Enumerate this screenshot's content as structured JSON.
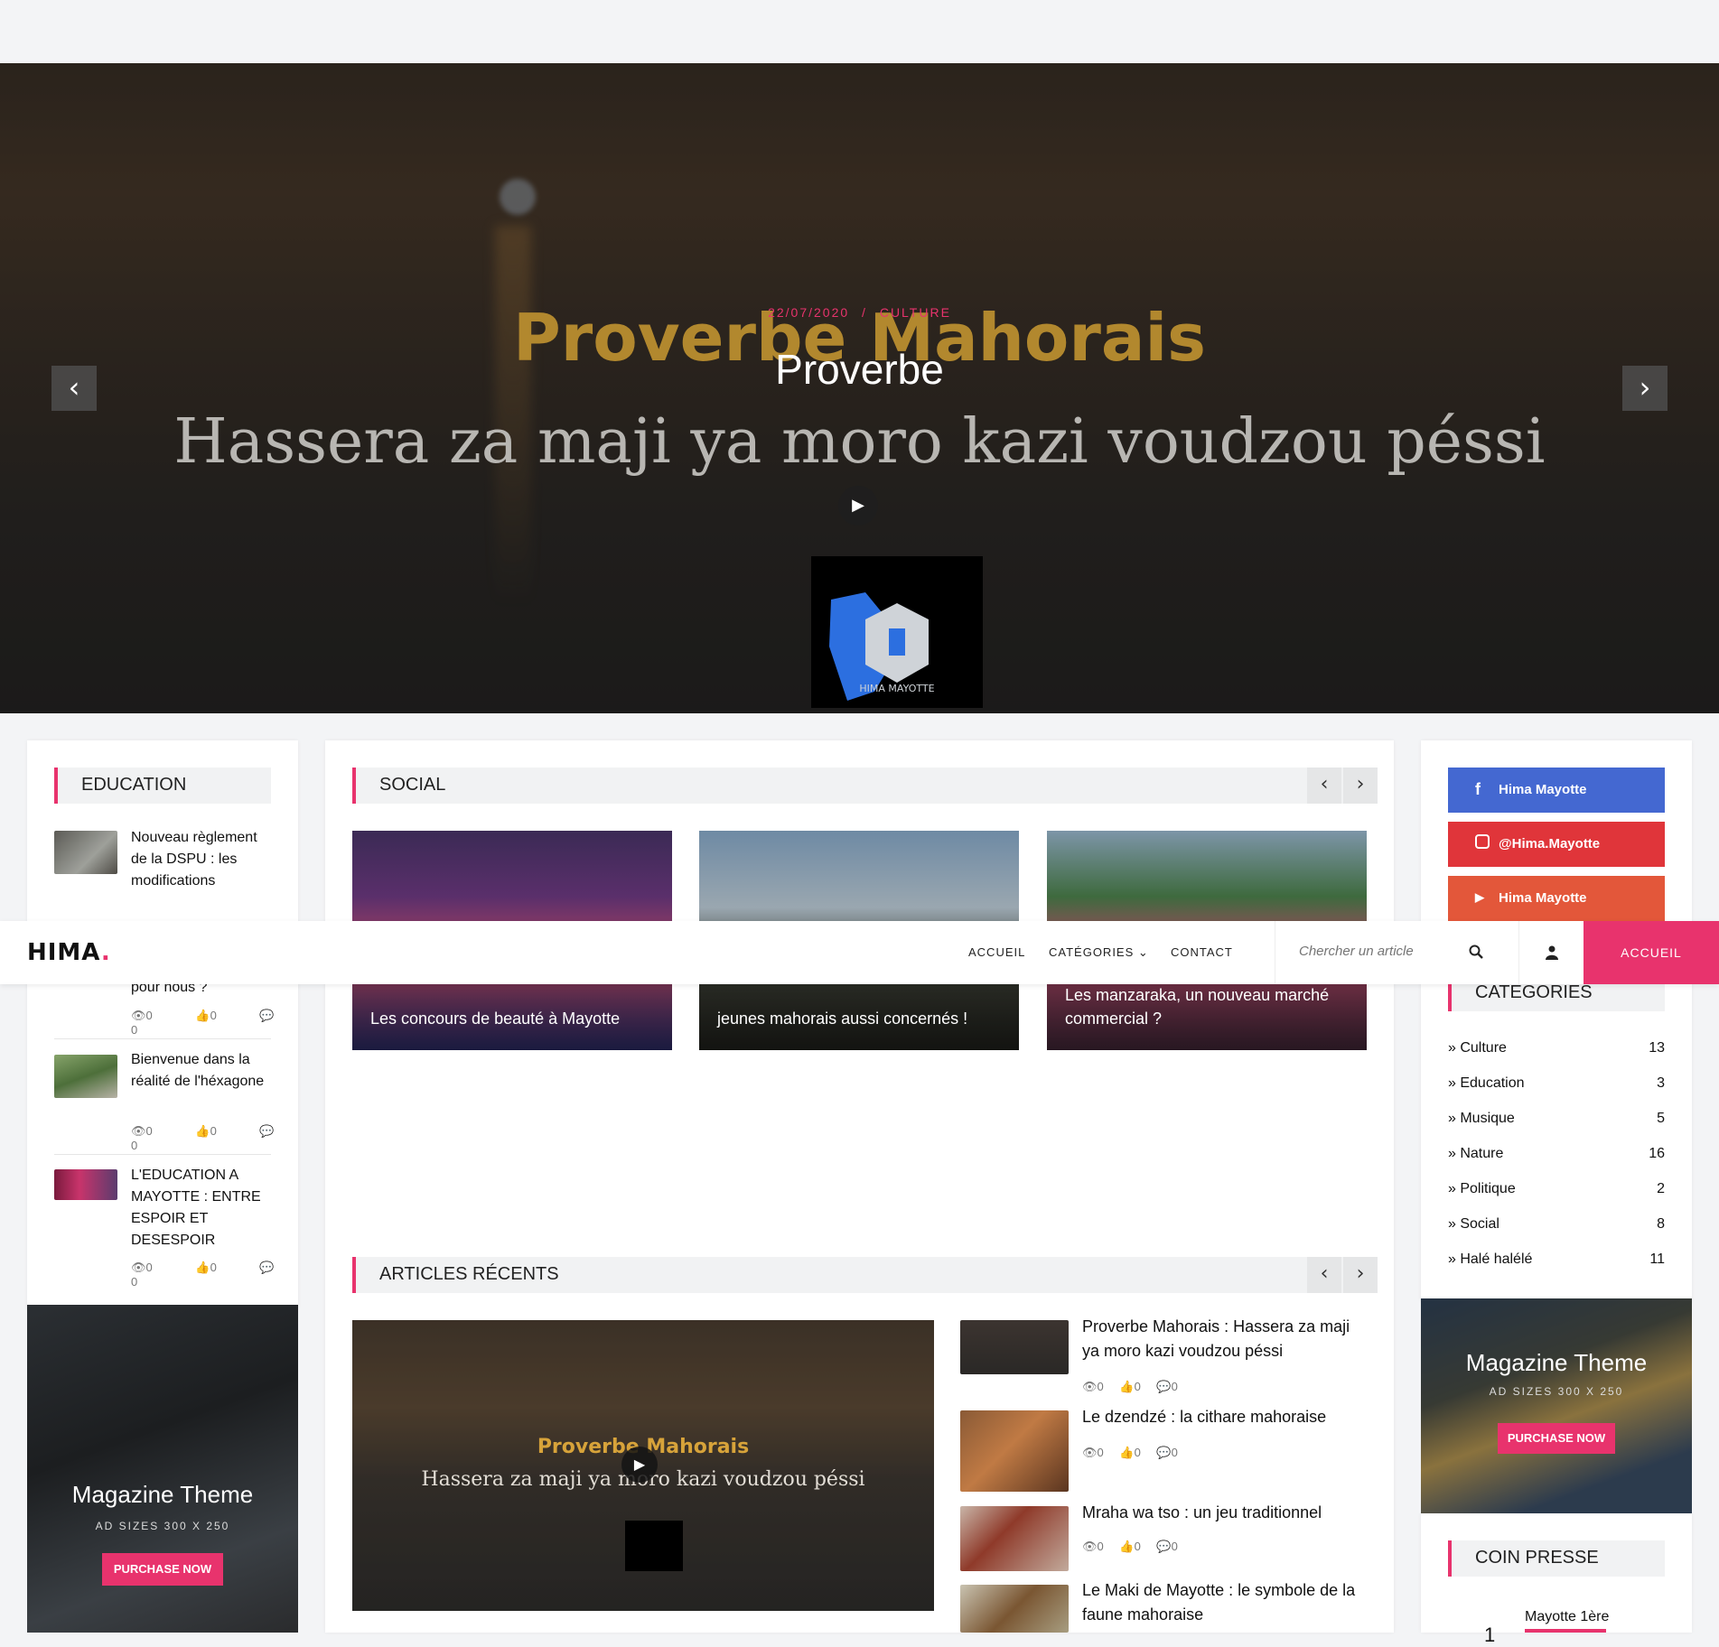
{
  "hero": {
    "date": "22/07/2020",
    "separator": "/",
    "category": "CULTURE",
    "image_title": "Proverbe Mahorais",
    "title": "Proverbe",
    "image_subtitle": "Hassera za maji ya moro kazi voudzou péssi",
    "logo_text": "HIMA MAYOTTE"
  },
  "header": {
    "logo": "HIMA",
    "logo_dot": ".",
    "nav": [
      "ACCUEIL",
      "CATÉGORIES",
      "CONTACT"
    ],
    "search_placeholder": "Chercher un article",
    "button": "ACCUEIL"
  },
  "education": {
    "heading": "EDUCATION",
    "items": [
      {
        "title": "Nouveau règlement de la DSPU : les modifications",
        "views": "0",
        "likes": "0",
        "comments": "0"
      },
      {
        "title": "pour nous ?",
        "views": "0",
        "likes": "0",
        "comments": "0"
      },
      {
        "title": "Bienvenue dans la réalité de l'héxagone",
        "views": "0",
        "likes": "0",
        "comments": "0"
      },
      {
        "title": "L'EDUCATION A MAYOTTE : ENTRE ESPOIR ET DESESPOIR",
        "views": "0",
        "likes": "0",
        "comments": "0"
      }
    ]
  },
  "social": {
    "heading": "SOCIAL",
    "cards": [
      {
        "caption": "Les concours de beauté à Mayotte"
      },
      {
        "caption": "jeunes mahorais aussi concernés !"
      },
      {
        "caption": "Les manzaraka, un nouveau marché commercial ?"
      }
    ]
  },
  "recent": {
    "heading": "ARTICLES RÉCENTS",
    "featured_image_title": "Proverbe Mahorais",
    "featured_image_subtitle": "Hassera za maji ya moro kazi voudzou péssi",
    "items": [
      {
        "title": "Proverbe Mahorais : Hassera za maji ya moro kazi voudzou péssi",
        "views": "0",
        "likes": "0",
        "comments": "0"
      },
      {
        "title": "Le dzendzé : la cithare mahoraise",
        "views": "0",
        "likes": "0",
        "comments": "0"
      },
      {
        "title": "Mraha wa tso : un jeu traditionnel",
        "views": "0",
        "likes": "0",
        "comments": "0"
      },
      {
        "title": "Le Maki de Mayotte : le symbole de la faune mahoraise"
      }
    ]
  },
  "sidebar": {
    "facebook": "Hima Mayotte",
    "instagram": "@Hima.Mayotte",
    "youtube": "Hima Mayotte",
    "categories_heading": "CATEGORIES",
    "categories": [
      {
        "label": "» Culture",
        "count": "13"
      },
      {
        "label": "» Education",
        "count": "3"
      },
      {
        "label": "» Musique",
        "count": "5"
      },
      {
        "label": "» Nature",
        "count": "16"
      },
      {
        "label": "» Politique",
        "count": "2"
      },
      {
        "label": "» Social",
        "count": "8"
      },
      {
        "label": "» Halé halélé",
        "count": "11"
      }
    ],
    "press_heading": "COIN PRESSE",
    "press_item": "Mayotte 1ère",
    "press_rank": "1"
  },
  "ads": {
    "title": "Magazine Theme",
    "sizes": "AD SIZES 300 X 250",
    "button": "PURCHASE NOW"
  },
  "colors": {
    "accent": "#e8336d",
    "facebook": "#4468d1",
    "instagram": "#e0353a",
    "youtube": "#e3573a"
  }
}
